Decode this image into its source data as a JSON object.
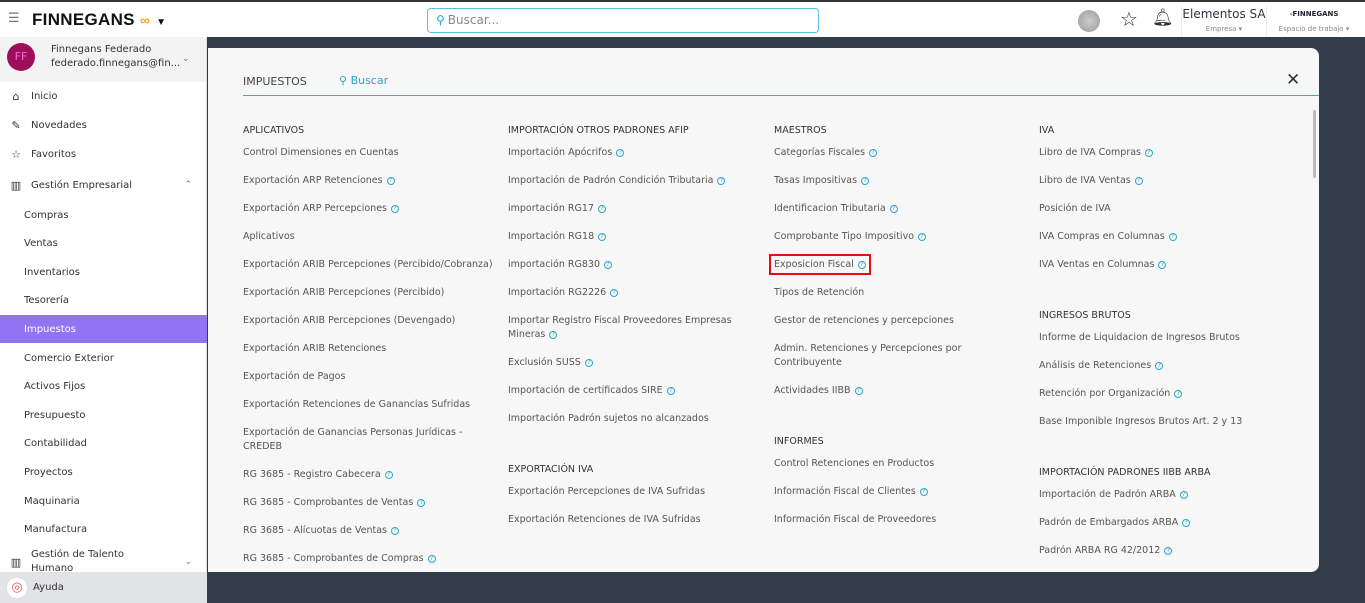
{
  "header": {
    "brand": "FINNEGANS",
    "search_placeholder": "Buscar...",
    "company": "Elementos SA",
    "company_label": "Empresa",
    "workspace_logo": "FINNEGANS",
    "workspace_label": "Espacio de trabajo"
  },
  "user": {
    "initials": "FF",
    "name": "Finnegans Federado",
    "email": "federado.finnegans@fin..."
  },
  "sidebar": {
    "items": [
      {
        "label": "Inicio",
        "icon": "home-icon"
      },
      {
        "label": "Novedades",
        "icon": "pin-icon"
      },
      {
        "label": "Favoritos",
        "icon": "star-icon"
      },
      {
        "label": "Gestión Empresarial",
        "icon": "building-icon",
        "expanded": true
      }
    ],
    "sub": [
      "Compras",
      "Ventas",
      "Inventarios",
      "Tesorería",
      "Impuestos",
      "Comercio Exterior",
      "Activos Fijos",
      "Presupuesto",
      "Contabilidad",
      "Proyectos",
      "Maquinaria",
      "Manufactura"
    ],
    "active": "Impuestos",
    "talento": "Gestión de Talento Humano",
    "help": "Ayuda"
  },
  "panel": {
    "title": "IMPUESTOS",
    "search_placeholder": "Buscar",
    "columns": [
      [
        {
          "title": "APLICATIVOS",
          "items": [
            {
              "l": "Control Dimensiones en Cuentas"
            },
            {
              "l": "Exportación ARP Retenciones",
              "h": true
            },
            {
              "l": "Exportación ARP Percepciones",
              "h": true
            },
            {
              "l": "Aplicativos"
            },
            {
              "l": "Exportación ARIB Percepciones (Percibido/Cobranza)"
            },
            {
              "l": "Exportación ARIB Percepciones (Percibido)"
            },
            {
              "l": "Exportación ARIB Percepciones (Devengado)"
            },
            {
              "l": "Exportación ARIB Retenciones"
            },
            {
              "l": "Exportación de Pagos"
            },
            {
              "l": "Exportación Retenciones de Ganancias Sufridas"
            },
            {
              "l": "Exportación de Ganancias Personas Jurídicas - CREDEB"
            },
            {
              "l": "RG 3685 - Registro Cabecera",
              "h": true
            },
            {
              "l": "RG 3685 - Comprobantes de Ventas",
              "h": true
            },
            {
              "l": "RG 3685 - Alícuotas de Ventas",
              "h": true
            },
            {
              "l": "RG 3685 - Comprobantes de Compras",
              "h": true
            }
          ]
        }
      ],
      [
        {
          "title": "IMPORTACIÓN OTROS PADRONES AFIP",
          "items": [
            {
              "l": "Importación Apócrifos",
              "h": true
            },
            {
              "l": "Importación de Padrón Condición Tributaria",
              "h": true
            },
            {
              "l": "importación RG17",
              "h": true
            },
            {
              "l": "Importación RG18",
              "h": true
            },
            {
              "l": "importación RG830",
              "h": true
            },
            {
              "l": "Importación RG2226",
              "h": true
            },
            {
              "l": "Importar Registro Fiscal Proveedores Empresas Mineras",
              "h": true
            },
            {
              "l": "Exclusión SUSS",
              "h": true
            },
            {
              "l": "Importación de certificados SIRE",
              "h": true
            },
            {
              "l": "Importación Padrón sujetos no alcanzados"
            }
          ]
        },
        {
          "title": "EXPORTACIÓN IVA",
          "items": [
            {
              "l": "Exportación Percepciones de IVA Sufridas"
            },
            {
              "l": "Exportación Retenciones de IVA Sufridas"
            }
          ]
        }
      ],
      [
        {
          "title": "MAESTROS",
          "items": [
            {
              "l": "Categorías Fiscales",
              "h": true
            },
            {
              "l": "Tasas Impositivas",
              "h": true
            },
            {
              "l": "Identificacion Tributaria",
              "h": true
            },
            {
              "l": "Comprobante Tipo Impositivo",
              "h": true
            },
            {
              "l": "Exposicion Fiscal",
              "h": true,
              "sel": true
            },
            {
              "l": "Tipos de Retención"
            },
            {
              "l": "Gestor de retenciones y percepciones"
            },
            {
              "l": "Admin. Retenciones y Percepciones por Contribuyente"
            },
            {
              "l": "Actividades IIBB",
              "h": true
            }
          ]
        },
        {
          "title": "INFORMES",
          "items": [
            {
              "l": "Control Retenciones en Productos"
            },
            {
              "l": "Información Fiscal de Clientes",
              "h": true
            },
            {
              "l": "Información Fiscal de Proveedores"
            }
          ]
        }
      ],
      [
        {
          "title": "IVA",
          "items": [
            {
              "l": "Libro de IVA Compras",
              "h": true
            },
            {
              "l": "Libro de IVA Ventas",
              "h": true
            },
            {
              "l": "Posición de IVA"
            },
            {
              "l": "IVA Compras en Columnas",
              "h": true
            },
            {
              "l": "IVA Ventas en Columnas",
              "h": true
            }
          ]
        },
        {
          "title": "INGRESOS BRUTOS",
          "items": [
            {
              "l": "Informe de Liquidacion de Ingresos Brutos"
            },
            {
              "l": "Análisis de Retenciones",
              "h": true
            },
            {
              "l": "Retención por Organización",
              "h": true
            },
            {
              "l": "Base Imponible Ingresos Brutos Art. 2 y 13"
            }
          ]
        },
        {
          "title": "IMPORTACIÓN PADRONES IIBB ARBA",
          "items": [
            {
              "l": "Importación de Padrón ARBA",
              "h": true
            },
            {
              "l": "Padrón de Embargados ARBA",
              "h": true
            },
            {
              "l": "Padrón ARBA RG 42/2012",
              "h": true
            }
          ]
        }
      ]
    ]
  },
  "colors": {
    "accent": "#9174f2",
    "dark_bg": "#323c4b",
    "link_teal": "#2aa8c7",
    "highlight": "#e01010"
  }
}
